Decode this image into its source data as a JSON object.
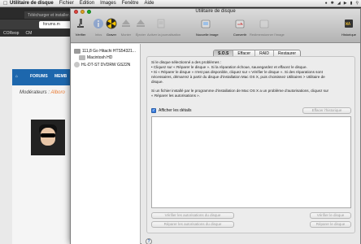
{
  "menubar": {
    "app_name": "Utilitaire de disque",
    "items": [
      "Fichier",
      "Édition",
      "Images",
      "Fenêtre",
      "Aide"
    ]
  },
  "browser": {
    "tab_title": "Télécharger et installer…",
    "address": "forums.m",
    "bookmarks": [
      "COReop",
      "CM"
    ],
    "nav": [
      "FORUMS",
      "MEMB"
    ],
    "moderators_label": "Modérateurs :",
    "moderators_name": "Alboro"
  },
  "window": {
    "title": "Utilitaire de disque",
    "toolbar": [
      {
        "label": "Vérifier",
        "icon": "microscope-icon",
        "enabled": true
      },
      {
        "label": "Infos",
        "icon": "info-icon",
        "enabled": false
      },
      {
        "label": "Graver",
        "icon": "burn-icon",
        "enabled": true
      },
      {
        "label": "Monter",
        "icon": "mount-icon",
        "enabled": false
      },
      {
        "label": "Éjecter",
        "icon": "eject-icon",
        "enabled": false
      },
      {
        "label": "Activer la journalisation",
        "icon": "journal-icon",
        "enabled": false
      },
      {
        "label": "Nouvelle image",
        "icon": "new-image-icon",
        "enabled": true
      },
      {
        "label": "Convertir",
        "icon": "convert-icon",
        "enabled": true
      },
      {
        "label": "Redimensionner l'image",
        "icon": "resize-icon",
        "enabled": false
      },
      {
        "label": "Historique",
        "icon": "log-icon",
        "enabled": true
      }
    ],
    "sidebar": {
      "disks": [
        {
          "label": "111,8 Go Hitachi HTS54321...",
          "level": 0
        },
        {
          "label": "Macintosh HD",
          "level": 1
        },
        {
          "label": "HL-DT-ST DVDRW GS22N",
          "level": 0
        }
      ]
    },
    "tabs": [
      "S.O.S",
      "Effacer",
      "RAID",
      "Restaurer"
    ],
    "active_tab": "S.O.S",
    "info_lines": [
      "Si le disque sélectionné a des problèmes :",
      "• Cliquez sur « Réparer le disque ». Si la réparation échoue, sauvegardez et effacez le disque.",
      "• Si « Réparer le disque » n'est pas disponible, cliquez sur « Vérifier le disque ». Si des réparations sont",
      "  nécessaires, démarrez à partir du disque d'installation Mac OS X, puis choisissez Utilitaires > Utilitaire de",
      "  disque.",
      "",
      "Si un fichier installé par le programme d'installation de Mac OS X a un problème d'autorisations, cliquez sur",
      "« Réparer les autorisations »."
    ],
    "show_details_label": "Afficher les détails",
    "show_details_checked": true,
    "clear_history_label": "Effacer l'historique",
    "buttons": {
      "verify_permissions": "Vérifier les autorisations du disque",
      "repair_permissions": "Réparer les autorisations du disque",
      "verify_disk": "Vérifier le disque",
      "repair_disk": "Réparer le disque"
    },
    "help_label": "?"
  }
}
